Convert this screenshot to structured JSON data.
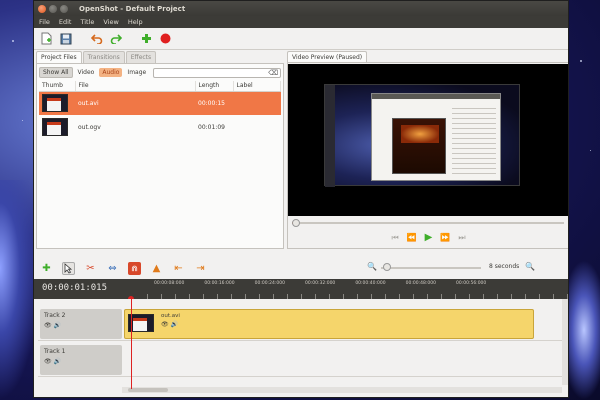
{
  "window": {
    "title": "OpenShot - Default Project"
  },
  "menu": [
    "File",
    "Edit",
    "Title",
    "View",
    "Help"
  ],
  "toolbar_icons": [
    "new-project-icon",
    "save-icon",
    "undo-icon",
    "redo-icon",
    "add-files-icon",
    "record-icon"
  ],
  "left_tabs": {
    "project_files": "Project Files",
    "transitions": "Transitions",
    "effects": "Effects"
  },
  "filters": {
    "show_all": "Show All",
    "video": "Video",
    "audio": "Audio",
    "image": "Image"
  },
  "file_table": {
    "columns": [
      "Thumb",
      "File",
      "Length",
      "Label"
    ],
    "rows": [
      {
        "file": "out.avi",
        "length": "00:00:15",
        "label": ""
      },
      {
        "file": "out.ogv",
        "length": "00:01:09",
        "label": ""
      }
    ]
  },
  "preview": {
    "tab": "Video Preview (Paused)"
  },
  "zoom": {
    "label": "8 seconds"
  },
  "timeline": {
    "timecode": "00:00:01:015",
    "ruler_labels": [
      "00:00:08:000",
      "00:00:16:000",
      "00:00:24:000",
      "00:00:32:000",
      "00:00:40:000",
      "00:00:48:000",
      "00:00:56:000"
    ],
    "tracks": [
      {
        "name": "Track 2",
        "clip": "out.avi"
      },
      {
        "name": "Track 1",
        "clip": ""
      }
    ]
  },
  "colors": {
    "accent": "#f07746",
    "clip": "#f5d56b",
    "playhead": "#dd2222"
  }
}
